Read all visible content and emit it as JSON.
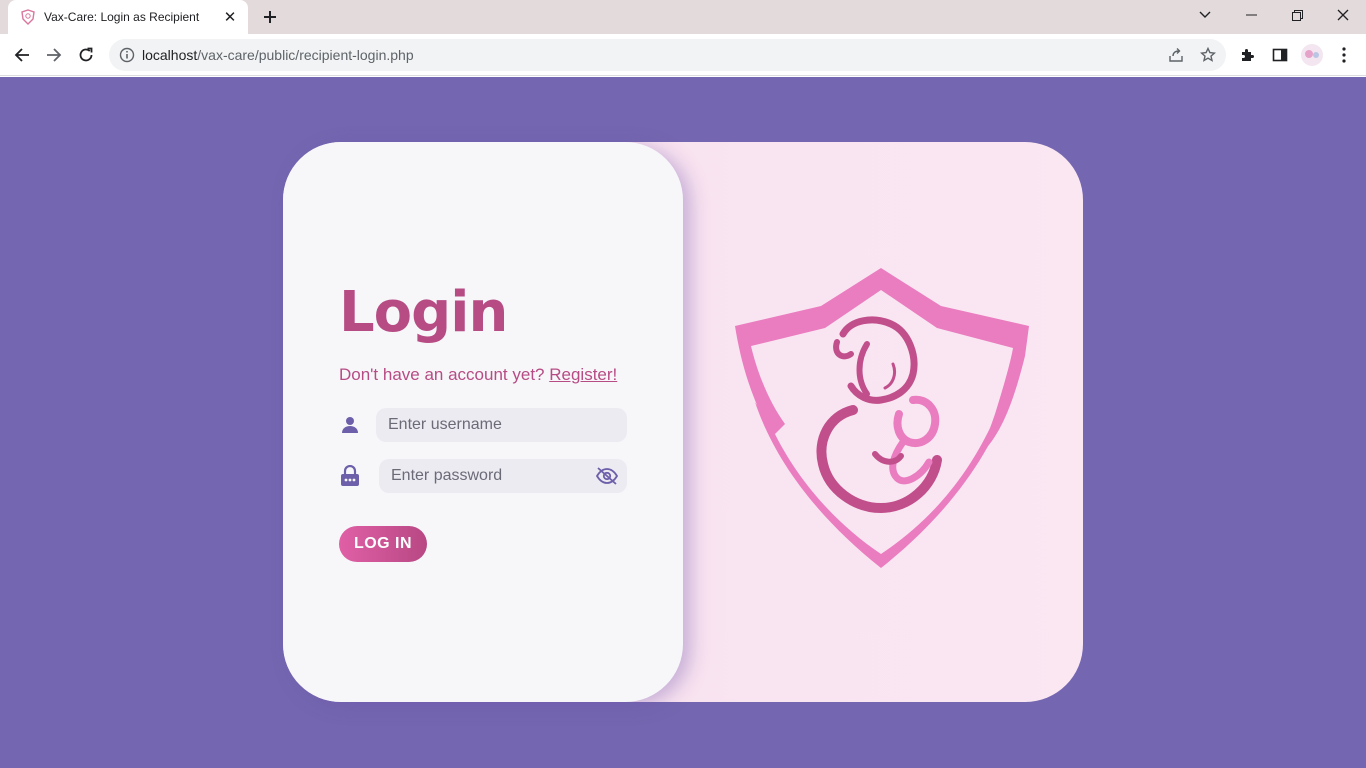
{
  "browser": {
    "tab_title": "Vax-Care: Login as Recipient",
    "url_host": "localhost",
    "url_path": "/vax-care/public/recipient-login.php"
  },
  "colors": {
    "page_background": "#7466b0",
    "accent_pink": "#b74c84",
    "button_gradient_start": "#e05fa6",
    "button_gradient_end": "#b84884",
    "logo_pink": "#ea7cc0",
    "icon_purple": "#6d5fa9"
  },
  "login": {
    "title": "Login",
    "register_prompt": "Don't have an account yet?",
    "register_link": "Register!",
    "username_placeholder": "Enter username",
    "password_placeholder": "Enter password",
    "submit_label": "LOG IN"
  },
  "icons": {
    "username": "user-icon",
    "password": "lock-icon",
    "password_toggle": "eye-slash-icon",
    "logo": "shield-mother-baby-logo"
  }
}
